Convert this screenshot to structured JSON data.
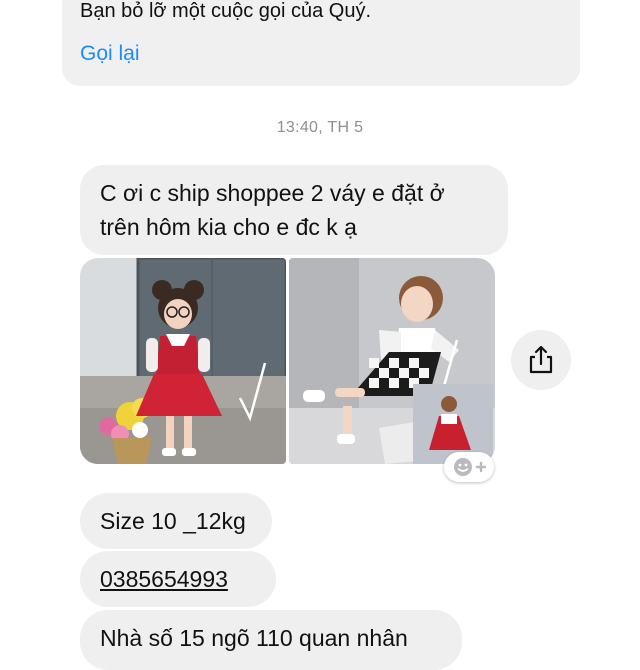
{
  "missed_call": {
    "text": "Bạn bỏ lỡ một cuộc gọi của Quý.",
    "call_back_label": "Gọi lại"
  },
  "timestamp": "13:40, TH 5",
  "messages": {
    "first": {
      "line1": "C ơi c ship shoppee 2 váy e đặt ở",
      "line2": "trên hôm kia cho e đc k ạ"
    },
    "size": "Size 10 _12kg",
    "phone": "0385654993",
    "address": "Nhà số 15 ngõ 110 quan nhân"
  },
  "icons": {
    "share": "share-icon",
    "reaction": "add-reaction-icon"
  },
  "colors": {
    "link": "#1a8cff",
    "bubble": "#efefef",
    "timestamp": "#8e8e93"
  }
}
